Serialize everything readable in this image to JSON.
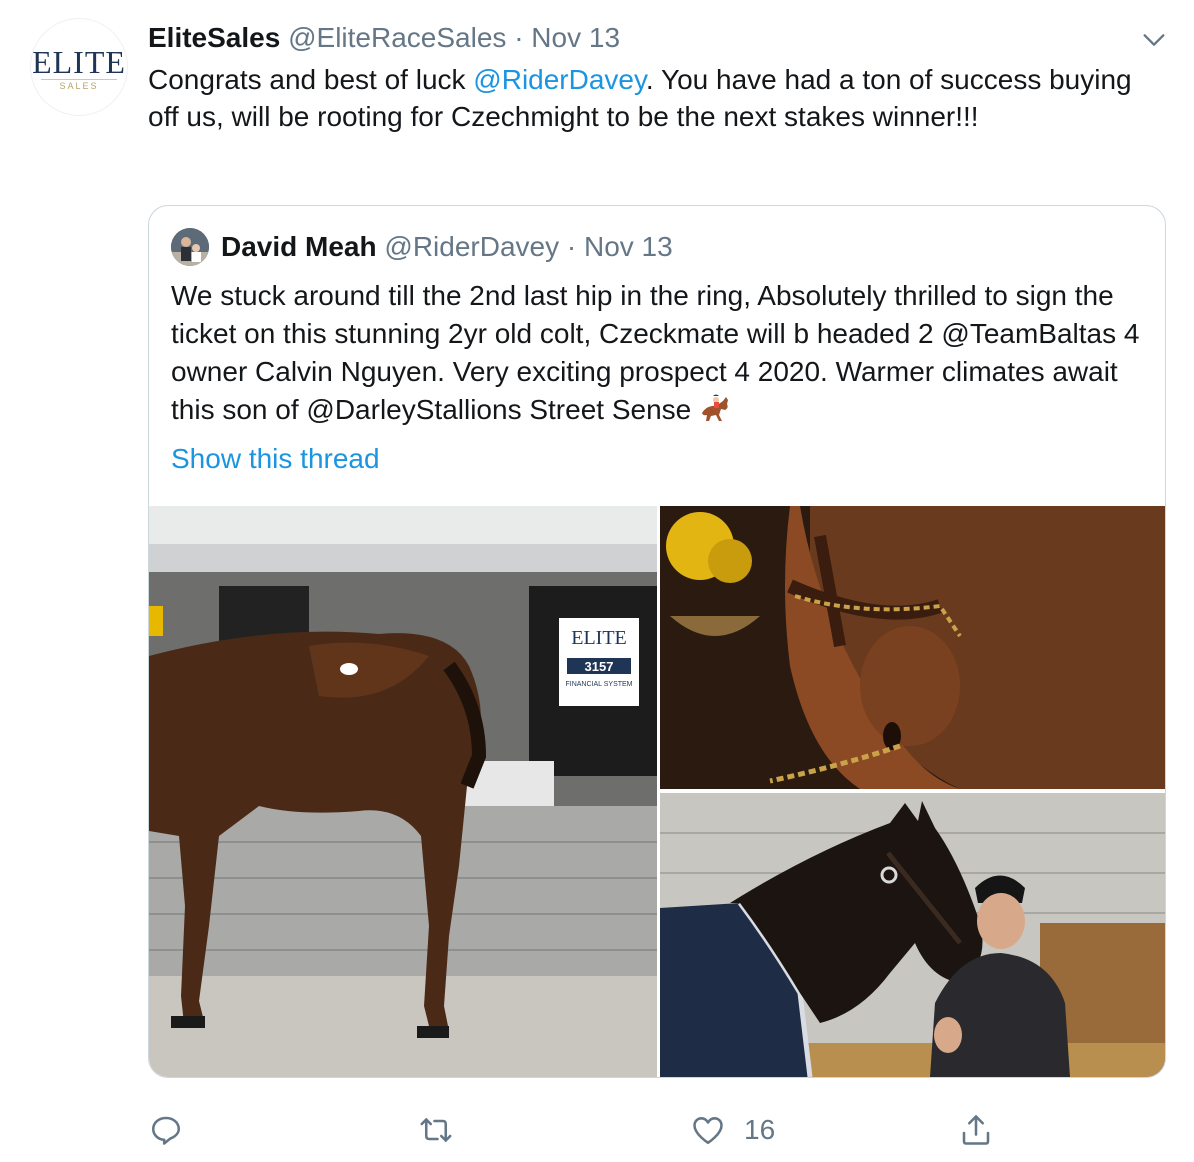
{
  "tweet": {
    "author_name": "EliteSales",
    "author_handle": "@EliteRaceSales",
    "separator": "·",
    "date": "Nov 13",
    "avatar_logo_text": "ELITE",
    "avatar_logo_sub": "SALES",
    "text_before_mention": "Congrats and best of luck ",
    "mention": "@RiderDavey",
    "text_after_mention": ". You have had a ton of success buying off us, will be rooting for Czechmight to be the next stakes winner!!!"
  },
  "quoted": {
    "author_name": "David Meah",
    "author_handle": "@RiderDavey",
    "separator": "·",
    "date": "Nov 13",
    "text": "We stuck around till the 2nd last hip in the ring, Absolutely thrilled to sign the ticket on this stunning 2yr old colt, Czeckmate will b headed 2 @TeamBaltas 4 owner Calvin Nguyen. Very exciting prospect 4 2020. Warmer climates await this son of @DarleyStallions Street Sense",
    "emoji": "horse-racing-emoji",
    "show_thread": "Show this thread",
    "photos": [
      {
        "name": "horse-side-photo",
        "sign_logo": "ELITE",
        "sign_number": "3157",
        "sign_caption": "FINANCIAL SYSTEM"
      },
      {
        "name": "horse-head-closeup-photo"
      },
      {
        "name": "horse-with-owner-photo"
      }
    ]
  },
  "actions": {
    "reply_icon": "reply-icon",
    "retweet_icon": "retweet-icon",
    "like_icon": "heart-icon",
    "like_count": "16",
    "share_icon": "share-icon"
  },
  "colors": {
    "link": "#1b95e0",
    "secondary_text": "#657786",
    "primary_text": "#14171a",
    "border": "#ccd6dd"
  }
}
